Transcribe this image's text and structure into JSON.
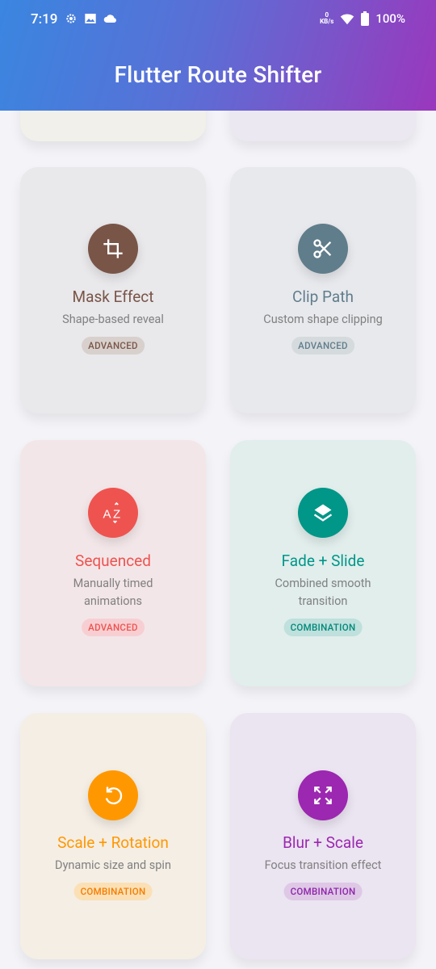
{
  "status_bar": {
    "time": "7:19",
    "net_speed_value": "0",
    "net_speed_unit": "KB/s",
    "battery": "100%"
  },
  "appbar": {
    "title": "Flutter Route Shifter"
  },
  "cards": [
    {
      "title": "Mask Effect",
      "description": "Shape-based reveal",
      "badge": "ADVANCED",
      "icon": "crop-icon",
      "color": "#795548"
    },
    {
      "title": "Clip Path",
      "description": "Custom shape clipping",
      "badge": "ADVANCED",
      "icon": "scissors-icon",
      "color": "#607D8B"
    },
    {
      "title": "Sequenced",
      "description": "Manually timed animations",
      "badge": "ADVANCED",
      "icon": "sort-az-icon",
      "color": "#EF5350"
    },
    {
      "title": "Fade + Slide",
      "description": "Combined smooth transition",
      "badge": "COMBINATION",
      "icon": "layers-icon",
      "color": "#009688"
    },
    {
      "title": "Scale + Rotation",
      "description": "Dynamic size and spin",
      "badge": "COMBINATION",
      "icon": "rotate-icon",
      "color": "#FF9800"
    },
    {
      "title": "Blur + Scale",
      "description": "Focus transition effect",
      "badge": "COMBINATION",
      "icon": "zoom-expand-icon",
      "color": "#9C27B0"
    }
  ]
}
